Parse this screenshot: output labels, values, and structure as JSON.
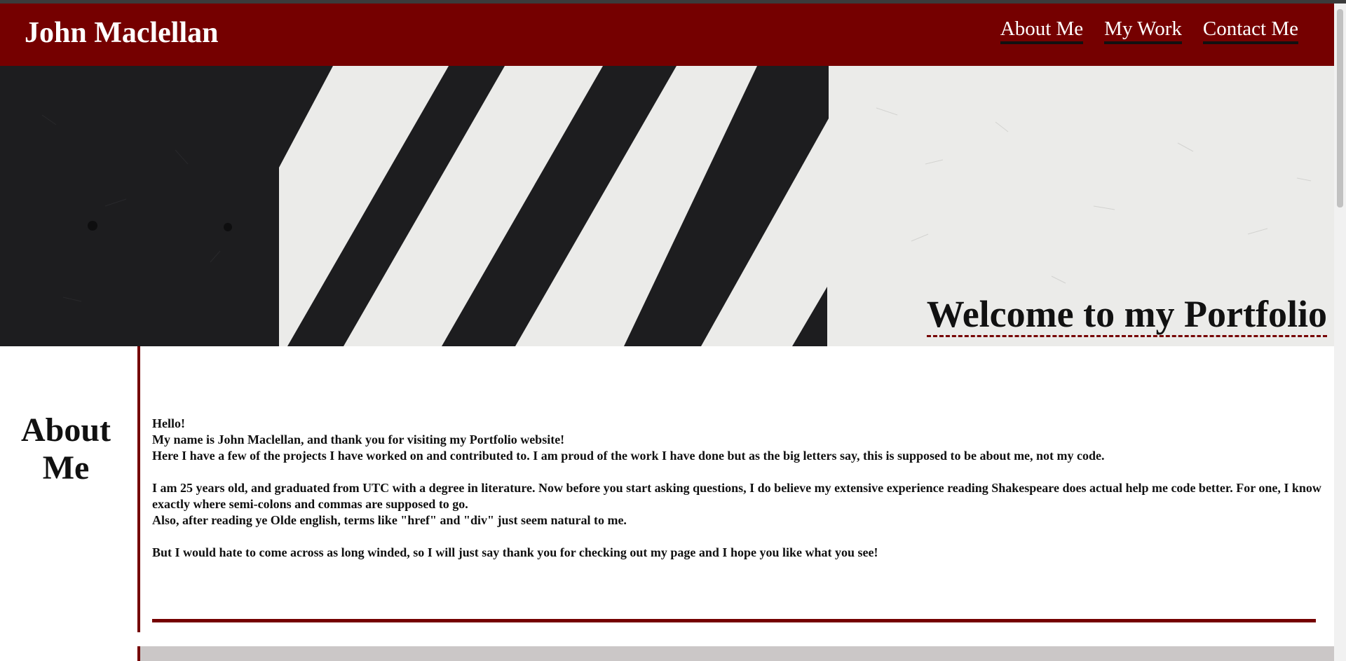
{
  "header": {
    "title": "John Maclellan",
    "nav": [
      "About Me",
      "My Work",
      "Contact Me"
    ]
  },
  "hero": {
    "title": "Welcome to my Portfolio"
  },
  "about": {
    "heading_line1": "About",
    "heading_line2": "Me",
    "lines": [
      "Hello!",
      "My name is John Maclellan, and thank you for visiting my Portfolio website!",
      "Here I have a few of the projects I have worked on and contributed to. I am proud of the work I have done but as the big letters say, this is supposed to be about me, not my code.",
      "I am 25 years old, and graduated from UTC with a degree in literature. Now before you start asking questions, I do believe my extensive experience reading Shakespeare does actual help me code better. For one, I know exactly where semi-colons and commas are supposed to go.",
      "Also, after reading ye Olde english, terms like \"href\" and \"div\" just seem natural to me.",
      "But I would hate to come across as long winded, so I will just say thank you for checking out my page and I hope you like what you see!"
    ]
  },
  "colors": {
    "brand": "#750000",
    "hero_dark": "#1c1c1e",
    "hero_light": "#ececea"
  }
}
